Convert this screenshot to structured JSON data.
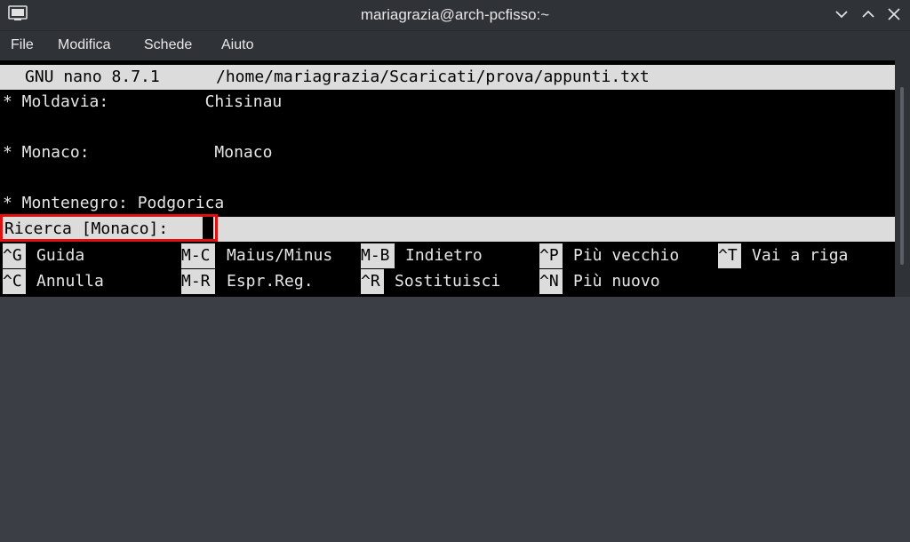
{
  "window": {
    "title": "mariagrazia@arch-pcfisso:~"
  },
  "menubar": {
    "items": [
      "File",
      "Modifica",
      "Schede",
      "Aiuto"
    ]
  },
  "nano": {
    "header_version": "GNU nano 8.7.1",
    "header_path": "/home/mariagrazia/Scaricati/prova/appunti.txt",
    "lines": [
      "* Moldavia:          Chisinau",
      "",
      "* Monaco:             Monaco",
      "",
      "* Montenegro: Podgorica"
    ],
    "prompt": "Ricerca [Monaco]:",
    "shortcuts_row1": [
      {
        "key": "^G",
        "label": "Guida"
      },
      {
        "key": "M-C",
        "label": "Maius/Minus"
      },
      {
        "key": "M-B",
        "label": "Indietro"
      },
      {
        "key": "^P",
        "label": "Più vecchio"
      },
      {
        "key": "^T",
        "label": "Vai a riga"
      }
    ],
    "shortcuts_row2": [
      {
        "key": "^C",
        "label": "Annulla"
      },
      {
        "key": "M-R",
        "label": "Espr.Reg."
      },
      {
        "key": "^R",
        "label": "Sostituisci"
      },
      {
        "key": "^N",
        "label": "Più nuovo"
      }
    ]
  },
  "colors": {
    "highlight": "#e01010",
    "terminal_bg": "#000000",
    "inverse_bg": "#dcdcdc"
  }
}
